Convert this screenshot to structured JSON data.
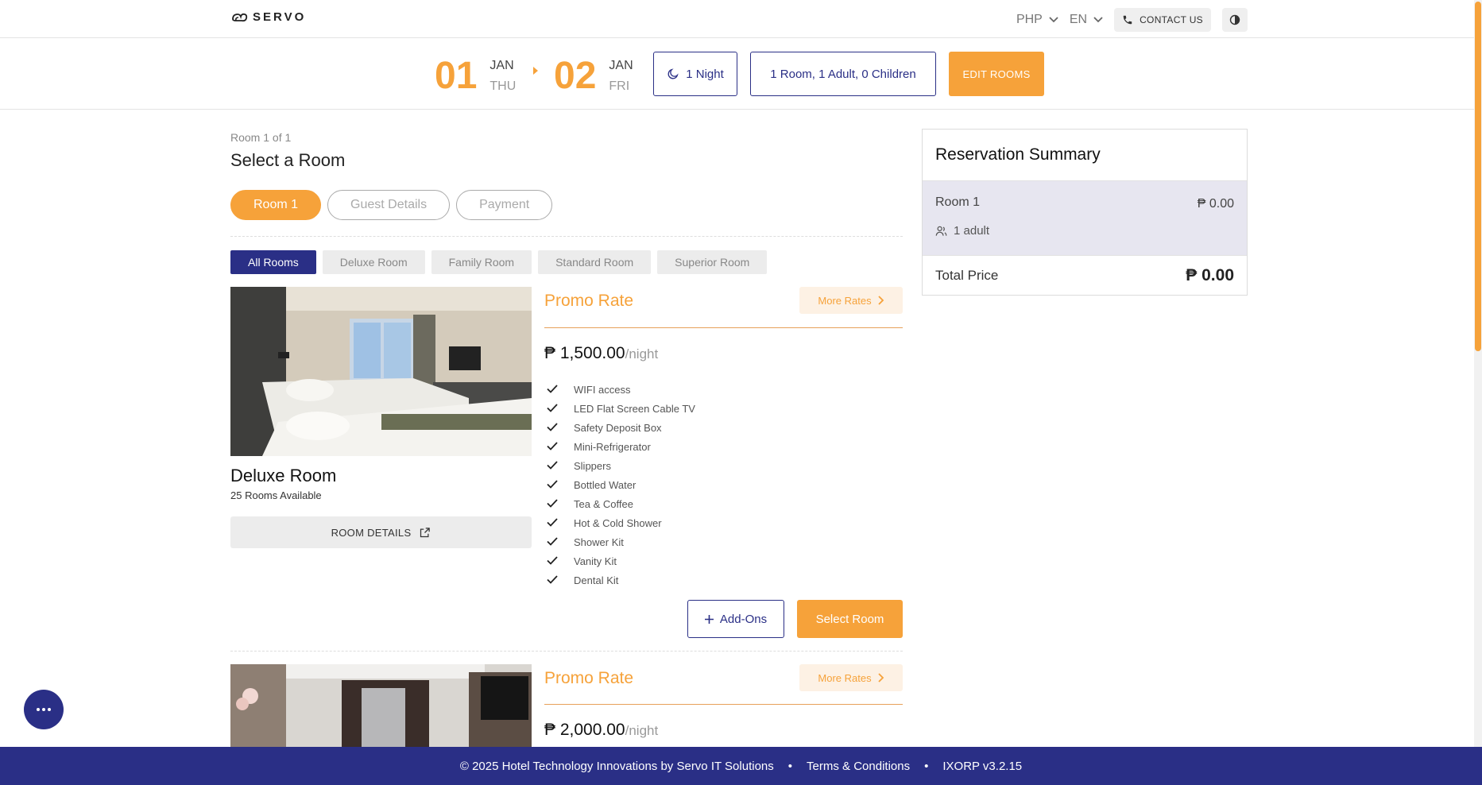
{
  "header": {
    "logo_text": "SERVO",
    "currency": "PHP",
    "language": "EN",
    "contact_label": "CONTACT US"
  },
  "dates": {
    "checkin_day": "01",
    "checkin_month": "JAN",
    "checkin_weekday": "THU",
    "checkout_day": "02",
    "checkout_month": "JAN",
    "checkout_weekday": "FRI",
    "nights": "1 Night",
    "guests": "1 Room, 1 Adult, 0 Children",
    "edit_rooms": "EDIT ROOMS"
  },
  "main": {
    "room_count": "Room 1 of 1",
    "title": "Select a Room",
    "steps": [
      "Room 1",
      "Guest Details",
      "Payment"
    ],
    "filters": [
      "All Rooms",
      "Deluxe Room",
      "Family Room",
      "Standard Room",
      "Superior Room"
    ]
  },
  "rooms": [
    {
      "name": "Deluxe Room",
      "availability": "25 Rooms Available",
      "details_label": "ROOM DETAILS",
      "rate_title": "Promo Rate",
      "more_rates": "More Rates",
      "currency_symbol": "₱",
      "price": "1,500.00",
      "per": "/night",
      "amenities": [
        "WIFI access",
        "LED Flat Screen Cable TV",
        "Safety Deposit Box",
        "Mini-Refrigerator",
        "Slippers",
        "Bottled Water",
        "Tea & Coffee",
        "Hot & Cold Shower",
        "Shower Kit",
        "Vanity Kit",
        "Dental Kit"
      ],
      "addons_label": "Add-Ons",
      "select_label": "Select Room"
    },
    {
      "rate_title": "Promo Rate",
      "more_rates": "More Rates",
      "currency_symbol": "₱",
      "price": "2,000.00",
      "per": "/night"
    }
  ],
  "summary": {
    "title": "Reservation Summary",
    "room_label": "Room 1",
    "room_amount": "₱ 0.00",
    "adults": "1 adult",
    "total_label": "Total Price",
    "total_amount": "₱ 0.00"
  },
  "footer": {
    "copyright": "© 2025 Hotel Technology Innovations by Servo IT Solutions",
    "terms": "Terms & Conditions",
    "version": "IXORP v3.2.15",
    "separator": "•"
  },
  "colors": {
    "accent": "#f6a23a",
    "primary": "#2a2f86",
    "summary_bg": "#e7e6f0"
  }
}
